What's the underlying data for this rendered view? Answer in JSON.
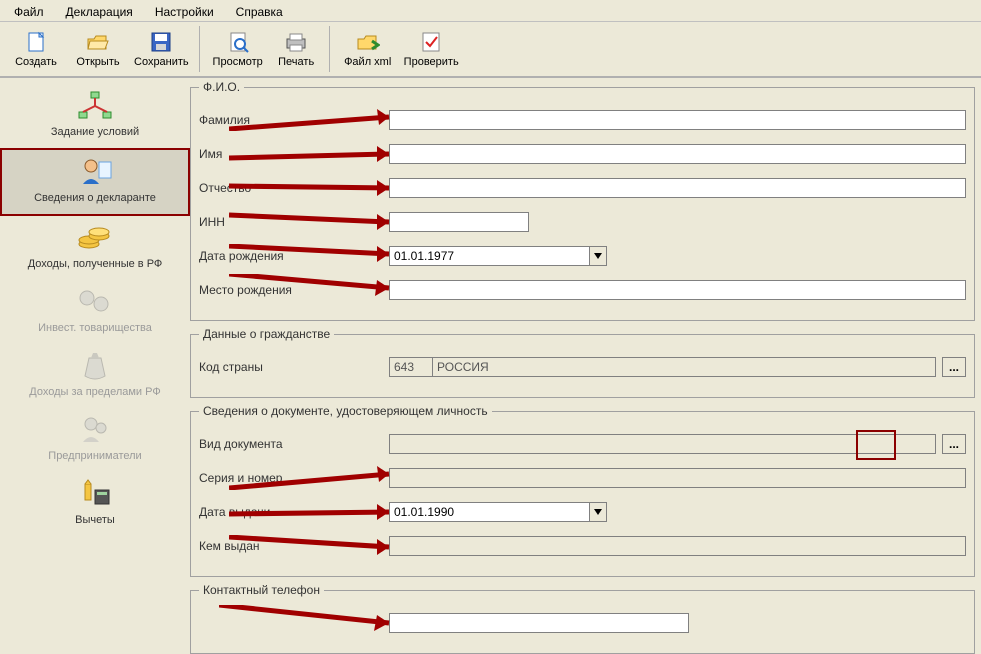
{
  "menu": {
    "file": "Файл",
    "decl": "Декларация",
    "settings": "Настройки",
    "help": "Справка"
  },
  "toolbar": {
    "create": "Создать",
    "open": "Открыть",
    "save": "Сохранить",
    "preview": "Просмотр",
    "print": "Печать",
    "xml": "Файл xml",
    "check": "Проверить"
  },
  "sidebar": {
    "cond": "Задание условий",
    "decl": "Сведения о декларанте",
    "income_rf": "Доходы, полученные в РФ",
    "invest": "Инвест. товарищества",
    "income_abroad": "Доходы за пределами РФ",
    "entrep": "Предприниматели",
    "deduct": "Вычеты"
  },
  "fio": {
    "legend": "Ф.И.О.",
    "surname_lbl": "Фамилия",
    "surname": "",
    "name_lbl": "Имя",
    "name": "",
    "patronymic_lbl": "Отчество",
    "patronymic": "",
    "inn_lbl": "ИНН",
    "inn": "",
    "dob_lbl": "Дата рождения",
    "dob": "01.01.1977",
    "pob_lbl": "Место рождения",
    "pob": ""
  },
  "citizen": {
    "legend": "Данные о гражданстве",
    "country_lbl": "Код страны",
    "country_code": "643",
    "country_name": "РОССИЯ",
    "dots": "..."
  },
  "doc": {
    "legend": "Сведения о документе, удостоверяющем личность",
    "type_lbl": "Вид документа",
    "type": "",
    "series_lbl": "Серия и номер",
    "series": "",
    "date_lbl": "Дата выдачи",
    "date": "01.01.1990",
    "issuer_lbl": "Кем выдан",
    "issuer": "",
    "dots": "..."
  },
  "phone": {
    "legend": "Контактный телефон",
    "value": ""
  }
}
